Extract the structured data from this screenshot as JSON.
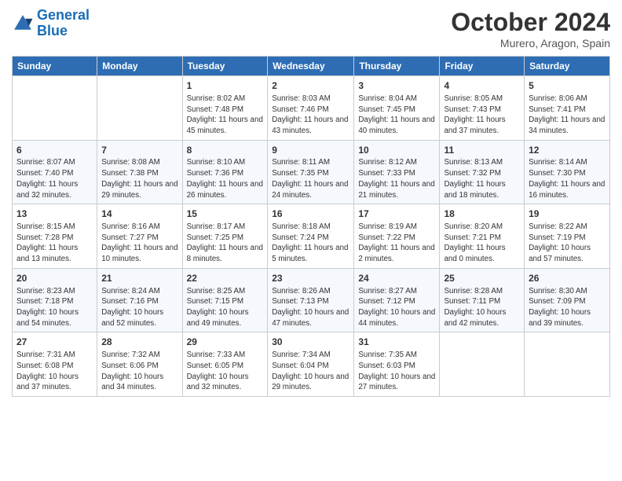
{
  "header": {
    "logo_general": "General",
    "logo_blue": "Blue",
    "month_title": "October 2024",
    "subtitle": "Murero, Aragon, Spain"
  },
  "days_of_week": [
    "Sunday",
    "Monday",
    "Tuesday",
    "Wednesday",
    "Thursday",
    "Friday",
    "Saturday"
  ],
  "weeks": [
    [
      {
        "day": "",
        "info": ""
      },
      {
        "day": "",
        "info": ""
      },
      {
        "day": "1",
        "info": "Sunrise: 8:02 AM\nSunset: 7:48 PM\nDaylight: 11 hours and 45 minutes."
      },
      {
        "day": "2",
        "info": "Sunrise: 8:03 AM\nSunset: 7:46 PM\nDaylight: 11 hours and 43 minutes."
      },
      {
        "day": "3",
        "info": "Sunrise: 8:04 AM\nSunset: 7:45 PM\nDaylight: 11 hours and 40 minutes."
      },
      {
        "day": "4",
        "info": "Sunrise: 8:05 AM\nSunset: 7:43 PM\nDaylight: 11 hours and 37 minutes."
      },
      {
        "day": "5",
        "info": "Sunrise: 8:06 AM\nSunset: 7:41 PM\nDaylight: 11 hours and 34 minutes."
      }
    ],
    [
      {
        "day": "6",
        "info": "Sunrise: 8:07 AM\nSunset: 7:40 PM\nDaylight: 11 hours and 32 minutes."
      },
      {
        "day": "7",
        "info": "Sunrise: 8:08 AM\nSunset: 7:38 PM\nDaylight: 11 hours and 29 minutes."
      },
      {
        "day": "8",
        "info": "Sunrise: 8:10 AM\nSunset: 7:36 PM\nDaylight: 11 hours and 26 minutes."
      },
      {
        "day": "9",
        "info": "Sunrise: 8:11 AM\nSunset: 7:35 PM\nDaylight: 11 hours and 24 minutes."
      },
      {
        "day": "10",
        "info": "Sunrise: 8:12 AM\nSunset: 7:33 PM\nDaylight: 11 hours and 21 minutes."
      },
      {
        "day": "11",
        "info": "Sunrise: 8:13 AM\nSunset: 7:32 PM\nDaylight: 11 hours and 18 minutes."
      },
      {
        "day": "12",
        "info": "Sunrise: 8:14 AM\nSunset: 7:30 PM\nDaylight: 11 hours and 16 minutes."
      }
    ],
    [
      {
        "day": "13",
        "info": "Sunrise: 8:15 AM\nSunset: 7:28 PM\nDaylight: 11 hours and 13 minutes."
      },
      {
        "day": "14",
        "info": "Sunrise: 8:16 AM\nSunset: 7:27 PM\nDaylight: 11 hours and 10 minutes."
      },
      {
        "day": "15",
        "info": "Sunrise: 8:17 AM\nSunset: 7:25 PM\nDaylight: 11 hours and 8 minutes."
      },
      {
        "day": "16",
        "info": "Sunrise: 8:18 AM\nSunset: 7:24 PM\nDaylight: 11 hours and 5 minutes."
      },
      {
        "day": "17",
        "info": "Sunrise: 8:19 AM\nSunset: 7:22 PM\nDaylight: 11 hours and 2 minutes."
      },
      {
        "day": "18",
        "info": "Sunrise: 8:20 AM\nSunset: 7:21 PM\nDaylight: 11 hours and 0 minutes."
      },
      {
        "day": "19",
        "info": "Sunrise: 8:22 AM\nSunset: 7:19 PM\nDaylight: 10 hours and 57 minutes."
      }
    ],
    [
      {
        "day": "20",
        "info": "Sunrise: 8:23 AM\nSunset: 7:18 PM\nDaylight: 10 hours and 54 minutes."
      },
      {
        "day": "21",
        "info": "Sunrise: 8:24 AM\nSunset: 7:16 PM\nDaylight: 10 hours and 52 minutes."
      },
      {
        "day": "22",
        "info": "Sunrise: 8:25 AM\nSunset: 7:15 PM\nDaylight: 10 hours and 49 minutes."
      },
      {
        "day": "23",
        "info": "Sunrise: 8:26 AM\nSunset: 7:13 PM\nDaylight: 10 hours and 47 minutes."
      },
      {
        "day": "24",
        "info": "Sunrise: 8:27 AM\nSunset: 7:12 PM\nDaylight: 10 hours and 44 minutes."
      },
      {
        "day": "25",
        "info": "Sunrise: 8:28 AM\nSunset: 7:11 PM\nDaylight: 10 hours and 42 minutes."
      },
      {
        "day": "26",
        "info": "Sunrise: 8:30 AM\nSunset: 7:09 PM\nDaylight: 10 hours and 39 minutes."
      }
    ],
    [
      {
        "day": "27",
        "info": "Sunrise: 7:31 AM\nSunset: 6:08 PM\nDaylight: 10 hours and 37 minutes."
      },
      {
        "day": "28",
        "info": "Sunrise: 7:32 AM\nSunset: 6:06 PM\nDaylight: 10 hours and 34 minutes."
      },
      {
        "day": "29",
        "info": "Sunrise: 7:33 AM\nSunset: 6:05 PM\nDaylight: 10 hours and 32 minutes."
      },
      {
        "day": "30",
        "info": "Sunrise: 7:34 AM\nSunset: 6:04 PM\nDaylight: 10 hours and 29 minutes."
      },
      {
        "day": "31",
        "info": "Sunrise: 7:35 AM\nSunset: 6:03 PM\nDaylight: 10 hours and 27 minutes."
      },
      {
        "day": "",
        "info": ""
      },
      {
        "day": "",
        "info": ""
      }
    ]
  ]
}
